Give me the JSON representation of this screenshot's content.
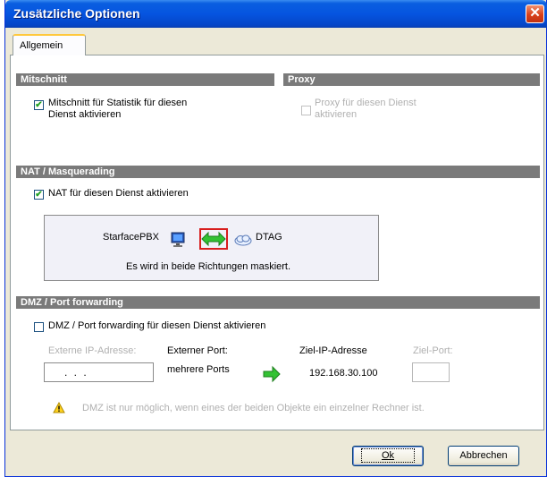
{
  "window": {
    "title": "Zusätzliche Optionen",
    "close_glyph": "✕"
  },
  "tabs": [
    {
      "label": "Allgemein"
    }
  ],
  "mitschnitt": {
    "header": "Mitschnitt",
    "checkbox_checked": true,
    "label_line1": "Mitschnitt für Statistik für diesen",
    "label_line2": "Dienst aktivieren"
  },
  "proxy": {
    "header": "Proxy",
    "checkbox_checked": false,
    "label_line1": "Proxy für diesen Dienst",
    "label_line2": "aktivieren"
  },
  "nat": {
    "header": "NAT / Masquerading",
    "checkbox_checked": true,
    "checkbox_label": "NAT für diesen Dienst aktivieren",
    "left_endpoint": "StarfacePBX",
    "right_endpoint": "DTAG",
    "description": "Es wird in beide Richtungen maskiert.",
    "icons": [
      "monitor-icon",
      "bidirectional-arrow-icon",
      "cloud-icon"
    ]
  },
  "dmz": {
    "header": "DMZ / Port forwarding",
    "checkbox_checked": false,
    "checkbox_label": "DMZ / Port forwarding für diesen Dienst aktivieren",
    "col_external_ip": "Externe IP-Adresse:",
    "col_external_port": "Externer Port:",
    "col_target_ip": "Ziel-IP-Adresse",
    "col_target_port": "Ziel-Port:",
    "external_ip_value": ". . .",
    "external_port_value": "mehrere Ports",
    "target_ip_value": "192.168.30.100",
    "target_port_value": "",
    "warning": "DMZ ist nur möglich, wenn eines der beiden Objekte ein einzelner Rechner ist."
  },
  "buttons": {
    "ok_label": "Ok",
    "cancel_label": "Abbrechen"
  },
  "colors": {
    "title_bar": "#0554e0",
    "section_header": "#7a7a7a",
    "highlight_border": "#d81e1e",
    "arrow_green": "#33c233"
  }
}
